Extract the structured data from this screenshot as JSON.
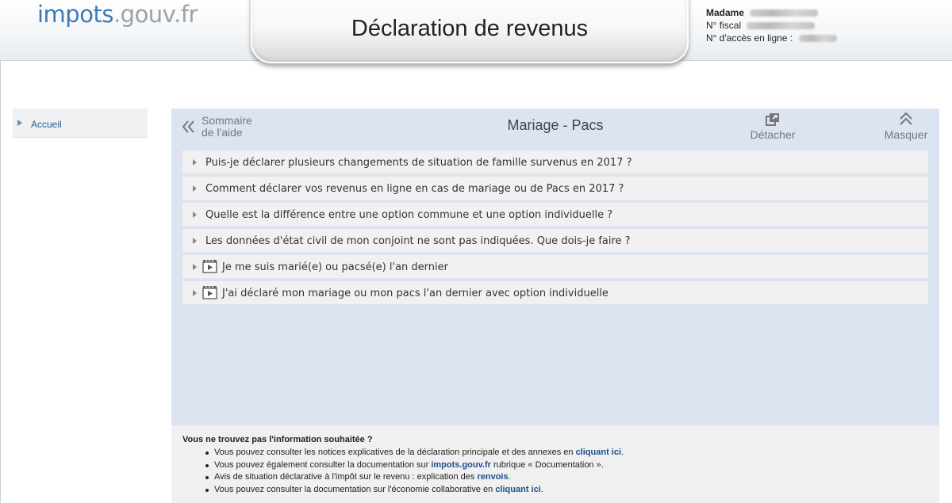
{
  "header": {
    "logo_part1": "impots",
    "logo_part2": ".gouv.fr",
    "title": "Déclaration de revenus",
    "user": {
      "name_label": "Madame",
      "fiscal_label": "N° fiscal",
      "access_label": "N° d'accès en ligne :"
    }
  },
  "sidebar": {
    "items": [
      {
        "label": "Accueil"
      }
    ]
  },
  "help_panel": {
    "back_line1": "Sommaire",
    "back_line2": "de l'aide",
    "title": "Mariage - Pacs",
    "detach_label": "Détacher",
    "hide_label": "Masquer",
    "faq": [
      {
        "text": "Puis-je déclarer plusieurs changements de situation de famille survenus en 2017 ?",
        "icon": "caret-right-icon"
      },
      {
        "text": "Comment déclarer vos revenus en ligne en cas de mariage ou de Pacs en 2017 ?",
        "icon": "caret-right-icon"
      },
      {
        "text": "Quelle est la différence entre une option commune et une option individuelle ?",
        "icon": "caret-right-icon"
      },
      {
        "text": "Les données d'état civil de mon conjoint ne sont pas indiquées. Que dois-je faire ?",
        "icon": "caret-right-icon"
      },
      {
        "text": "Je me suis marié(e) ou pacsé(e) l'an dernier",
        "icon": "video-icon"
      },
      {
        "text": "J'ai déclaré mon mariage ou mon pacs l'an dernier avec option individuelle",
        "icon": "video-icon"
      }
    ]
  },
  "info": {
    "heading": "Vous ne trouvez pas l'information souhaitée ?",
    "lines": [
      {
        "before": "Vous pouvez consulter les notices explicatives de la déclaration principale et des annexes en ",
        "link": "cliquant ici",
        "after": "."
      },
      {
        "before": "Vous pouvez également consulter la documentation sur ",
        "link": "impots.gouv.fr",
        "after": " rubrique « Documentation »."
      },
      {
        "before": "Avis de situation déclarative à l'impôt sur le revenu : explication des ",
        "link": "renvois",
        "after": "."
      },
      {
        "before": "Vous pouvez consulter la documentation sur l'économie collaborative en ",
        "link": "cliquant ici",
        "after": "."
      }
    ]
  },
  "colors": {
    "brand_blue": "#3b7ab7",
    "panel_bg": "#dce4f2",
    "link": "#1f4e8c"
  }
}
